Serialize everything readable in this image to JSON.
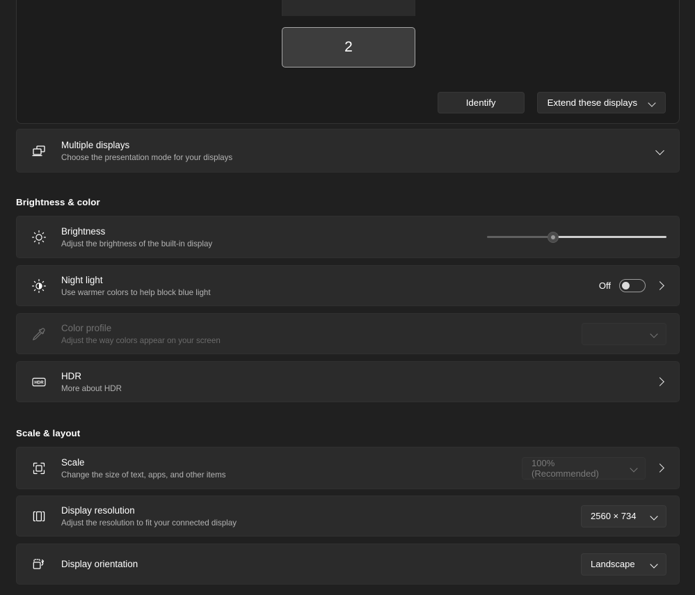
{
  "display_preview": {
    "monitors": [
      {
        "label": "",
        "name": "display-1"
      },
      {
        "label": "2",
        "name": "display-2"
      }
    ],
    "identify_button": "Identify",
    "mode_dropdown": "Extend these displays"
  },
  "multiple_displays": {
    "icon": "multiple-displays-icon",
    "title": "Multiple displays",
    "subtitle": "Choose the presentation mode for your displays",
    "expander": "chevron-down-icon"
  },
  "sections": {
    "brightness_color": "Brightness & color",
    "scale_layout": "Scale & layout"
  },
  "brightness": {
    "icon": "brightness-sun-icon",
    "title": "Brightness",
    "subtitle": "Adjust the brightness of the built-in display",
    "value": 35
  },
  "night_light": {
    "icon": "night-light-icon",
    "title": "Night light",
    "subtitle": "Use warmer colors to help block blue light",
    "state_label": "Off",
    "enabled": false
  },
  "color_profile": {
    "icon": "eyedropper-icon",
    "title": "Color profile",
    "subtitle": "Adjust the way colors appear on your screen",
    "value": "",
    "disabled": true
  },
  "hdr": {
    "icon": "hdr-icon",
    "title": "HDR",
    "subtitle": "More about HDR"
  },
  "scale": {
    "icon": "scale-icon",
    "title": "Scale",
    "subtitle": "Change the size of text, apps, and other items",
    "value": "100% (Recommended)",
    "disabled": true
  },
  "display_resolution": {
    "icon": "display-resolution-icon",
    "title": "Display resolution",
    "subtitle": "Adjust the resolution to fit your connected display",
    "value": "2560 × 734"
  },
  "display_orientation": {
    "icon": "display-orientation-icon",
    "title": "Display orientation",
    "value": "Landscape"
  },
  "colors": {
    "page_background": "#202020",
    "card_background": "#2b2b2b",
    "text_primary": "#ffffff",
    "text_secondary": "#b3b3b3",
    "text_disabled": "#717171"
  }
}
